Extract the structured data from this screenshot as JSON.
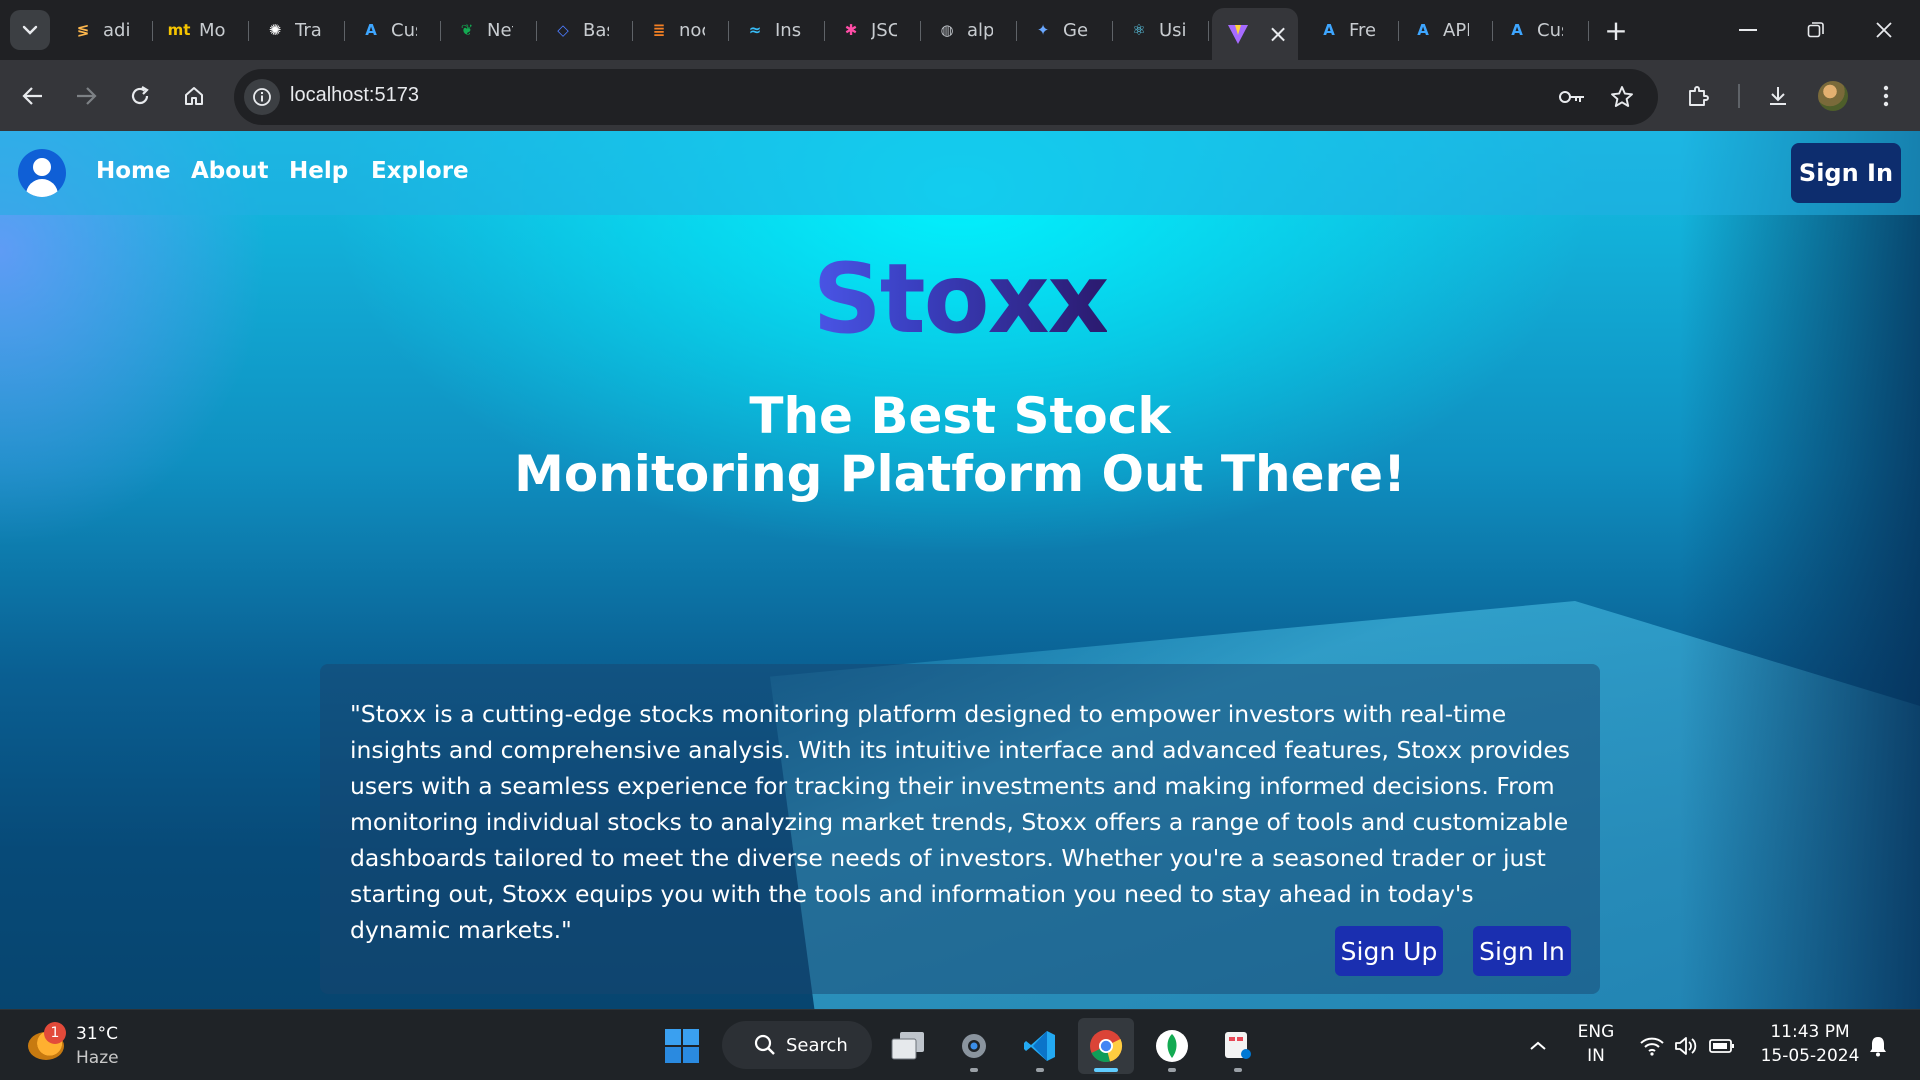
{
  "browser": {
    "tabs": [
      {
        "label": "adi",
        "icon": "clerk-icon",
        "glyph": "≶",
        "color": "#ffb84d"
      },
      {
        "label": "Mo",
        "icon": "mt-icon",
        "glyph": "mt",
        "color": "#f5c400"
      },
      {
        "label": "Tra",
        "icon": "openai-icon",
        "glyph": "✺",
        "color": "#ffffff"
      },
      {
        "label": "Cus",
        "icon": "auth0-a-icon",
        "glyph": "A",
        "color": "#3ea6ff"
      },
      {
        "label": "Net",
        "icon": "mongodb-leaf-icon",
        "glyph": "❦",
        "color": "#13aa52"
      },
      {
        "label": "Bas",
        "icon": "shield-icon",
        "glyph": "◇",
        "color": "#4d7cff"
      },
      {
        "label": "noc",
        "icon": "stack-icon",
        "glyph": "≣",
        "color": "#f48024"
      },
      {
        "label": "Inst",
        "icon": "tailwind-icon",
        "glyph": "≈",
        "color": "#38bdf8"
      },
      {
        "label": "JSC",
        "icon": "jscolor-icon",
        "glyph": "✱",
        "color": "#ff4da6"
      },
      {
        "label": "alp",
        "icon": "globe-icon",
        "glyph": "◍",
        "color": "#bdc1c6"
      },
      {
        "label": "Ger",
        "icon": "gemini-sparkle-icon",
        "glyph": "✦",
        "color": "#6aa8ff"
      },
      {
        "label": "Usi",
        "icon": "react-icon",
        "glyph": "⚛",
        "color": "#61dafb"
      },
      {
        "label": "Fre",
        "icon": "auth0-a-icon",
        "glyph": "A",
        "color": "#3ea6ff"
      },
      {
        "label": "API",
        "icon": "auth0-a-icon",
        "glyph": "A",
        "color": "#3ea6ff"
      },
      {
        "label": "Cus",
        "icon": "auth0-a-icon",
        "glyph": "A",
        "color": "#3ea6ff"
      }
    ],
    "active_tab": {
      "icon": "vite-icon",
      "close": "×"
    },
    "new_tab": "+",
    "url": "localhost:5173"
  },
  "page": {
    "nav": {
      "links": [
        "Home",
        "About",
        "Help",
        "Explore"
      ],
      "signin": "Sign In"
    },
    "brand": "Stoxx",
    "tagline_line1": "The Best Stock",
    "tagline_line2": "Monitoring Platform Out There!",
    "description": "\"Stoxx is a cutting-edge stocks monitoring platform designed to empower investors with real-time insights and comprehensive analysis. With its intuitive interface and advanced features, Stoxx provides users with a seamless experience for tracking their investments and making informed decisions. From monitoring individual stocks to analyzing market trends, Stoxx offers a range of tools and customizable dashboards tailored to meet the diverse needs of investors. Whether you're a seasoned trader or just starting out, Stoxx equips you with the tools and information you need to stay ahead in today's dynamic markets.\"",
    "signup_button": "Sign Up",
    "signin_button": "Sign In",
    "colors": {
      "brand_start": "#4a55e6",
      "brand_end": "#2b1a6e",
      "button": "#1a2fb0",
      "nav_signin": "#0d2d6e"
    }
  },
  "taskbar": {
    "weather": {
      "temp": "31°C",
      "desc": "Haze",
      "badge": "1"
    },
    "search": "Search",
    "lang": {
      "line1": "ENG",
      "line2": "IN"
    },
    "time": "11:43 PM",
    "date": "15-05-2024"
  }
}
